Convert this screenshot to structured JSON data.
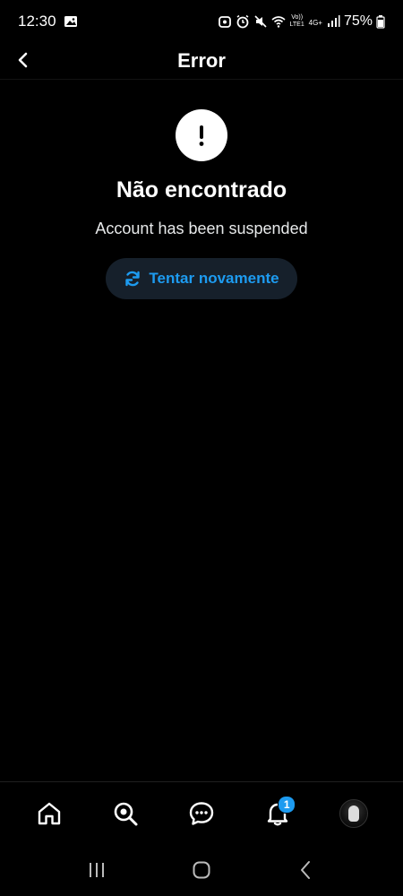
{
  "status_bar": {
    "time": "12:30",
    "battery": "75%",
    "network": "4G+",
    "volte": "Vo)) LTE1"
  },
  "header": {
    "title": "Error"
  },
  "error": {
    "title": "Não encontrado",
    "message": "Account has been suspended",
    "retry_label": "Tentar novamente",
    "accent_color": "#1d9bf0"
  },
  "bottom_nav": {
    "items": [
      {
        "icon": "home-icon"
      },
      {
        "icon": "search-icon"
      },
      {
        "icon": "messages-icon"
      },
      {
        "icon": "notifications-icon",
        "badge": "1"
      },
      {
        "icon": "avatar"
      }
    ]
  },
  "system_nav": {
    "items": [
      "recent-apps-icon",
      "home-circle-icon",
      "back-chevron-icon"
    ]
  }
}
